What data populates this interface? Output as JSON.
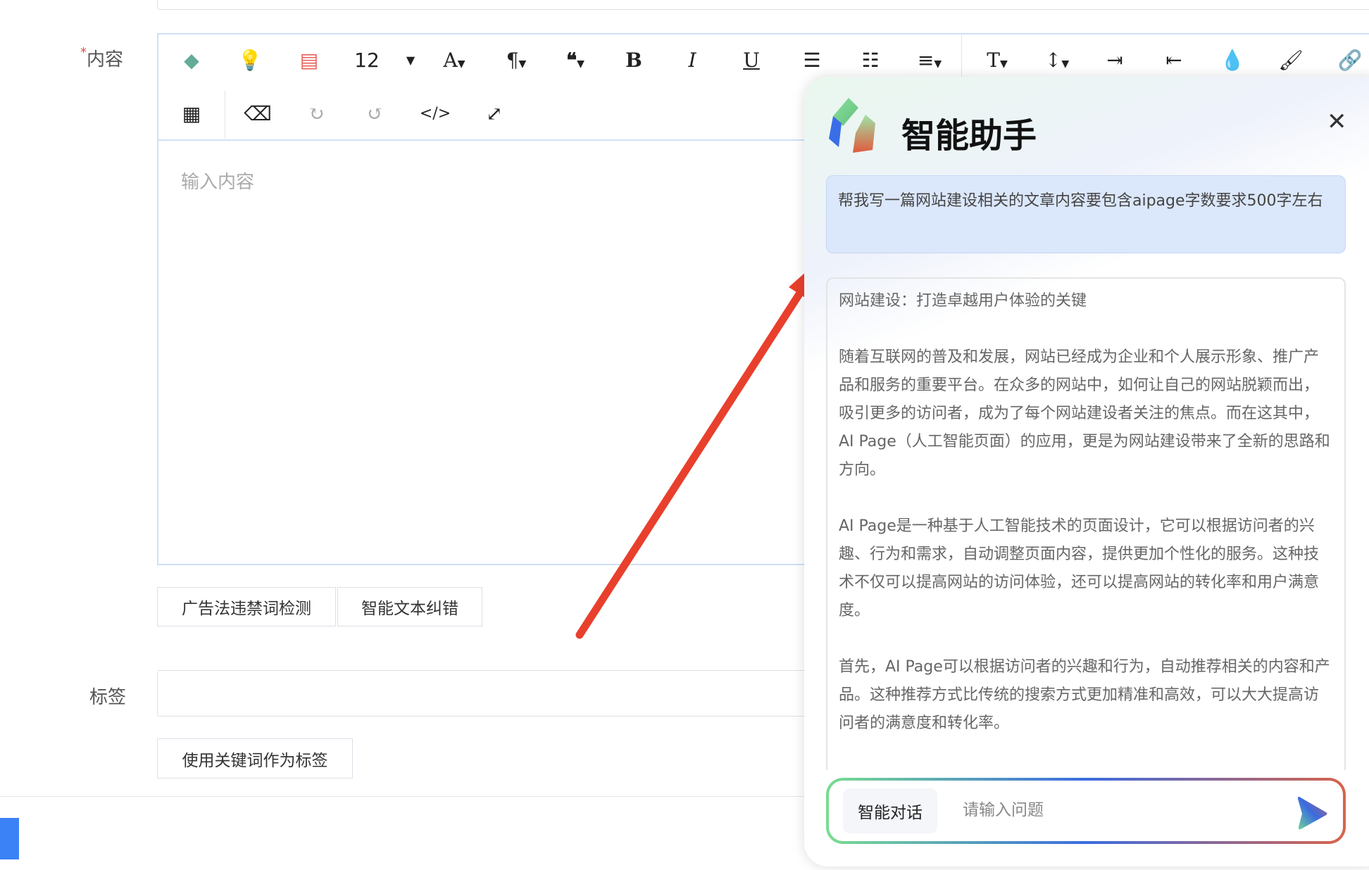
{
  "form": {
    "content_label": "内容",
    "required_mark": "*",
    "editor_placeholder": "输入内容",
    "font_size": "12",
    "buttons": {
      "ad_check": "广告法违禁词检测",
      "text_correct": "智能文本纠错",
      "use_keywords": "使用关键词作为标签"
    },
    "tags_label": "标签"
  },
  "assistant": {
    "title": "智能助手",
    "user_message": "帮我写一篇网站建设相关的文章内容要包含aipage字数要求500字左右",
    "answer": [
      "网站建设：打造卓越用户体验的关键",
      "随着互联网的普及和发展，网站已经成为企业和个人展示形象、推广产品和服务的重要平台。在众多的网站中，如何让自己的网站脱颖而出，吸引更多的访问者，成为了每个网站建设者关注的焦点。而在这其中，AI Page（人工智能页面）的应用，更是为网站建设带来了全新的思路和方向。",
      "AI Page是一种基于人工智能技术的页面设计，它可以根据访问者的兴趣、行为和需求，自动调整页面内容，提供更加个性化的服务。这种技术不仅可以提高网站的访问体验，还可以提高网站的转化率和用户满意度。",
      "首先，AI Page可以根据访问者的兴趣和行为，自动推荐相关的内容和产品。这种推荐方式比传统的搜索方式更加精准和高效，可以大大提高访问者的满意度和转化率。"
    ],
    "mode_label": "智能对话",
    "input_placeholder": "请输入问题"
  },
  "colors": {
    "annotation_arrow": "#e8402c",
    "editor_border": "#cfe0f6",
    "bubble": "#dbe7fb"
  }
}
